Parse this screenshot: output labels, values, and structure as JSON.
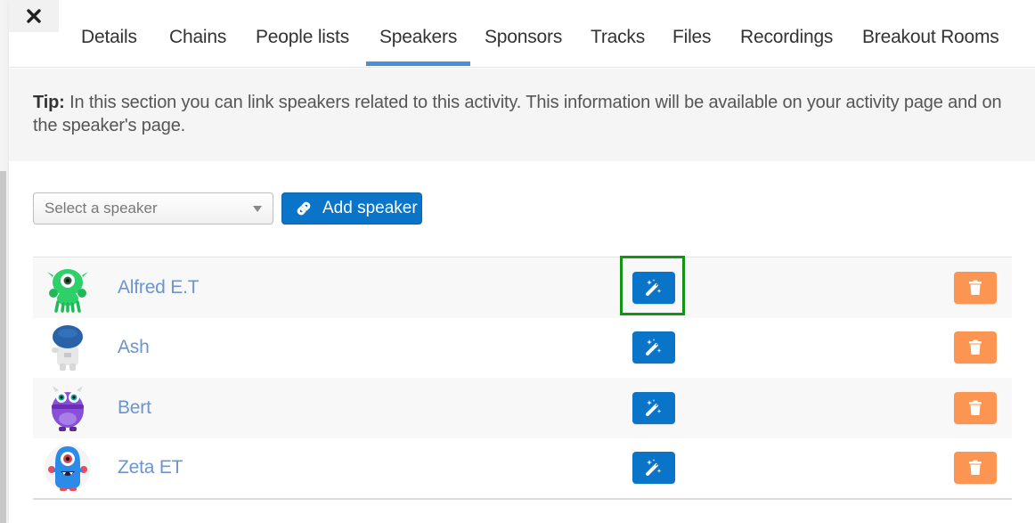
{
  "close": {
    "icon": "close-icon"
  },
  "tabs": [
    {
      "label": "Details",
      "active": false
    },
    {
      "label": "Chains",
      "active": false
    },
    {
      "label": "People lists",
      "active": false
    },
    {
      "label": "Speakers",
      "active": true
    },
    {
      "label": "Sponsors",
      "active": false
    },
    {
      "label": "Tracks",
      "active": false
    },
    {
      "label": "Files",
      "active": false
    },
    {
      "label": "Recordings",
      "active": false
    },
    {
      "label": "Breakout Rooms",
      "active": false
    }
  ],
  "tip": {
    "label": "Tip:",
    "text": " In this section you can link speakers related to this activity. This information will be available on your activity page and on the speaker's page."
  },
  "speaker_select": {
    "placeholder": "Select a speaker",
    "icon": "caret-down-icon"
  },
  "add_button": {
    "label": "Add speaker",
    "icon": "link-icon"
  },
  "speakers": [
    {
      "name": "Alfred E.T",
      "avatar": "green-alien-avatar",
      "highlighted": true
    },
    {
      "name": "Ash",
      "avatar": "astronaut-avatar",
      "highlighted": false
    },
    {
      "name": "Bert",
      "avatar": "purple-monster-avatar",
      "highlighted": false
    },
    {
      "name": "Zeta ET",
      "avatar": "blue-monster-avatar",
      "highlighted": false
    }
  ],
  "row_actions": {
    "edit_icon": "magic-wand-icon",
    "delete_icon": "trash-icon"
  },
  "colors": {
    "primary": "#0a74c9",
    "danger": "#fb9551",
    "tab_active": "#4a90d9",
    "link": "#6a95cf",
    "highlight": "#149414"
  }
}
